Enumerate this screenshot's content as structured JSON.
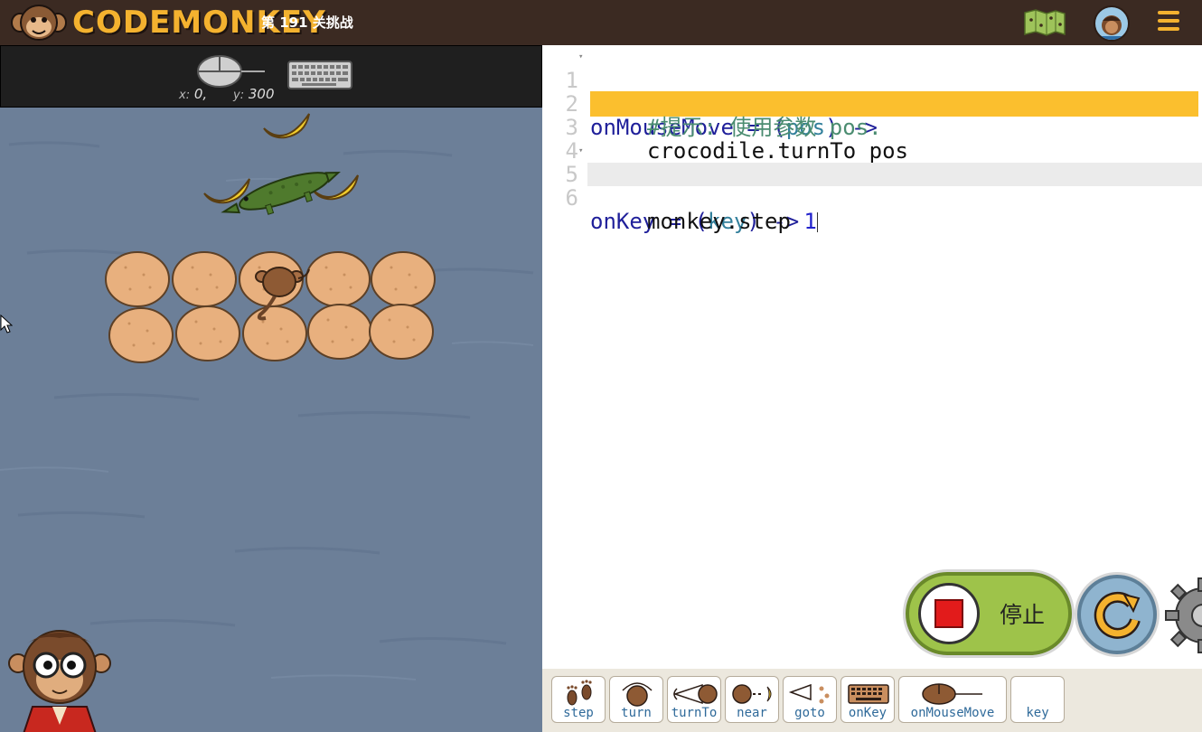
{
  "header": {
    "logo_text": "CODEMONKEY",
    "level_title": "第 191 关挑战",
    "map_icon": "map-icon",
    "avatar_icon": "avatar-icon",
    "menu_icon": "hamburger-menu-icon"
  },
  "game": {
    "input_bar": {
      "mouse_icon": "mouse-icon",
      "keyboard_icon": "keyboard-icon",
      "x_label": "x:",
      "x_value": "0,",
      "y_label": "y:",
      "y_value": "300"
    }
  },
  "editor": {
    "lines": [
      {
        "number": "1",
        "fold": true
      },
      {
        "number": "2",
        "fold": false
      },
      {
        "number": "3",
        "fold": false
      },
      {
        "number": "4",
        "fold": false
      },
      {
        "number": "5",
        "fold": true
      },
      {
        "number": "6",
        "fold": false
      }
    ],
    "code": {
      "l1_name": "onMouseMove",
      "l1_eq": " = (",
      "l1_param": "pos",
      "l1_arrow": ") ->",
      "l2_comment": "#提示: 使用参数 pos.",
      "l3_code": "crocodile.turnTo pos",
      "l5_name": "onKey",
      "l5_eq": " = (",
      "l5_param": "key",
      "l5_arrow": ") ->",
      "l6_code": "monkey.step ",
      "l6_num": "1"
    },
    "highlighted_line": 3,
    "active_line": 6
  },
  "controls": {
    "stop_label": "停止",
    "stop_icon": "stop-square-icon",
    "reset_icon": "reset-arrow-icon",
    "settings_icon": "gear-icon"
  },
  "palette": {
    "items": [
      {
        "label": "step",
        "icon": "footprints-icon"
      },
      {
        "label": "turn",
        "icon": "turn-icon"
      },
      {
        "label": "turnTo",
        "icon": "turnto-icon"
      },
      {
        "label": "near",
        "icon": "near-icon"
      },
      {
        "label": "goto",
        "icon": "goto-icon"
      },
      {
        "label": "onKey",
        "icon": "keyboard-icon"
      },
      {
        "label": "onMouseMove",
        "icon": "mouse-icon"
      },
      {
        "label": "key",
        "icon": ""
      }
    ]
  },
  "colors": {
    "topbar": "#3b2a22",
    "brand_yellow": "#f4b22f",
    "water": "#6d8099",
    "highlight": "#fbbf2e",
    "stop_green": "#9ec34a",
    "reset_blue": "#8fb4cf",
    "palette_label": "#2f6a9a"
  }
}
